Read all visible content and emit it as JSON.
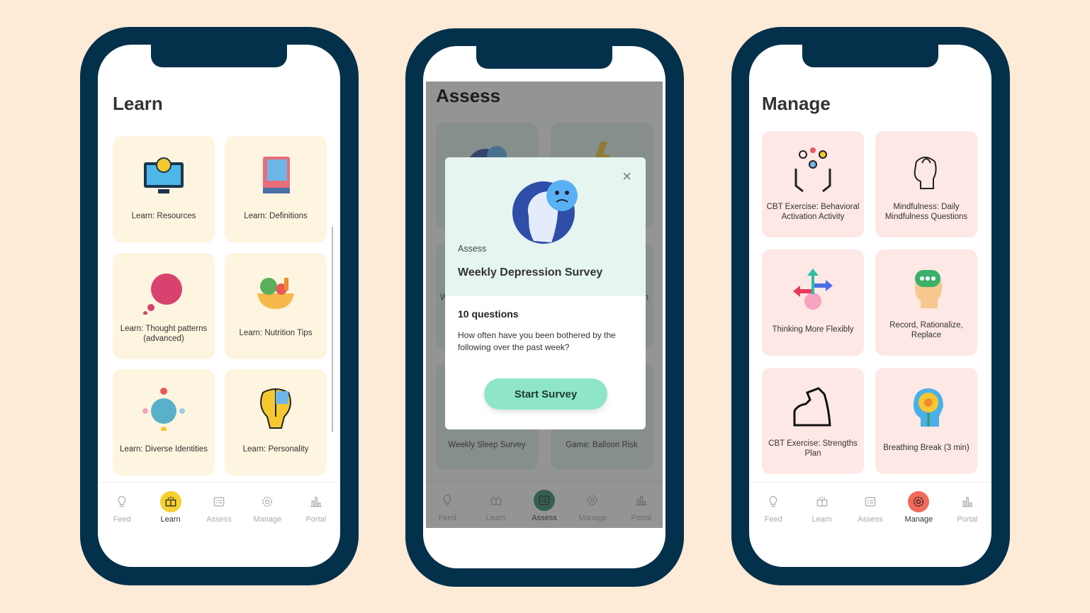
{
  "colors": {
    "background": "#fdead7",
    "frame": "#03304a",
    "learn_card": "#fdf5df",
    "manage_card": "#fde8e6",
    "learn_active": "#f6d02f",
    "assess_active": "#2f8a72",
    "manage_active": "#f26a5a",
    "modal_top": "#e6f5f0",
    "start_button": "#8fe5c9"
  },
  "nav_items": [
    "Feed",
    "Learn",
    "Assess",
    "Manage",
    "Portal"
  ],
  "nav_icons": [
    "lightbulb-icon",
    "book-icon",
    "list-icon",
    "gear-icon",
    "bar-chart-icon"
  ],
  "learn": {
    "title": "Learn",
    "active_tab": 1,
    "cards": [
      {
        "label": "Learn: Resources",
        "icon": "monitor-lightbulb-icon"
      },
      {
        "label": "Learn: Definitions",
        "icon": "dictionary-icon"
      },
      {
        "label": "Learn: Thought patterns (advanced)",
        "icon": "thought-cloud-icon"
      },
      {
        "label": "Learn: Nutrition Tips",
        "icon": "salad-bowl-icon"
      },
      {
        "label": "Learn: Diverse Identities",
        "icon": "globe-people-icon"
      },
      {
        "label": "Learn: Personality",
        "icon": "puzzle-head-icon"
      }
    ]
  },
  "assess": {
    "title": "Assess",
    "active_tab": 2,
    "cards": [
      {
        "label": "",
        "icon": "sad-head-icon"
      },
      {
        "label": "",
        "icon": "brain-lightning-icon"
      },
      {
        "label": "W",
        "icon": ""
      },
      {
        "label": "n",
        "icon": ""
      },
      {
        "label": "Weekly Sleep Survey",
        "icon": ""
      },
      {
        "label": "Game: Balloon Risk",
        "icon": ""
      }
    ],
    "modal": {
      "category": "Assess",
      "title": "Weekly Depression Survey",
      "questions": "10 questions",
      "description": "How often have you been bothered by the following over the past week?",
      "button": "Start Survey",
      "close": "×"
    }
  },
  "manage": {
    "title": "Manage",
    "active_tab": 3,
    "cards": [
      {
        "label": "CBT Exercise: Behavioral Activation Activity",
        "icon": "juggling-hands-icon"
      },
      {
        "label": "Mindfulness: Daily Mindfulness Questions",
        "icon": "mindful-head-icon"
      },
      {
        "label": "Thinking More Flexibly",
        "icon": "brain-arrows-icon"
      },
      {
        "label": "Record, Rationalize, Replace",
        "icon": "speech-head-icon"
      },
      {
        "label": "CBT Exercise: Strengths Plan",
        "icon": "flexed-arm-icon"
      },
      {
        "label": "Breathing Break (3 min)",
        "icon": "flower-head-icon"
      }
    ]
  }
}
